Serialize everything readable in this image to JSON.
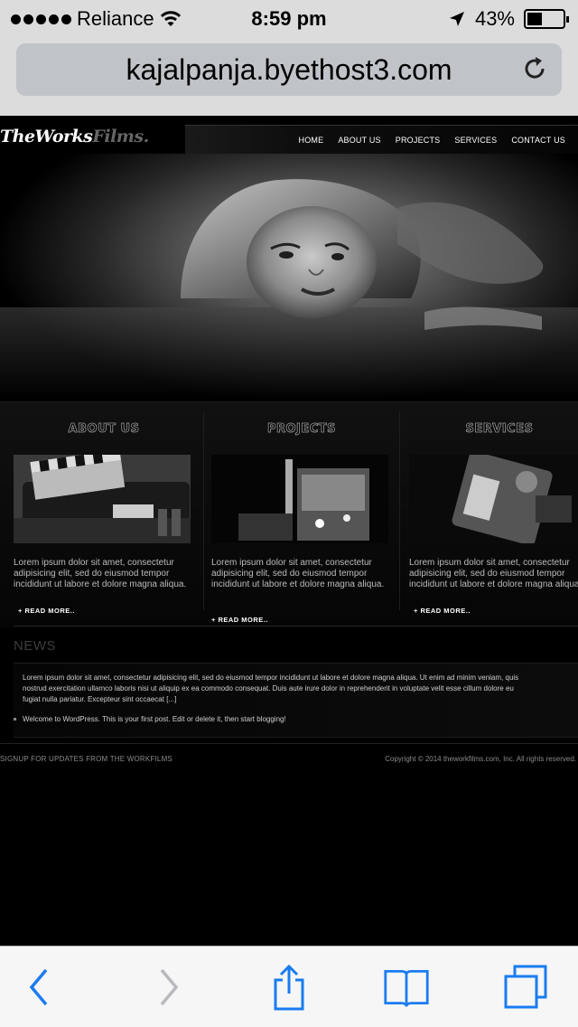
{
  "status_bar": {
    "carrier": "Reliance",
    "time": "8:59 pm",
    "battery": "43%",
    "battery_level": 0.43,
    "icons": [
      "signal-dots-icon",
      "wifi-icon",
      "location-arrow-icon",
      "battery-icon"
    ]
  },
  "url_bar": {
    "url": "kajalpanja.byethost3.com",
    "reload_icon": "reload-icon"
  },
  "site": {
    "logo_main": "TheWorks",
    "logo_suffix": "Films.",
    "nav": [
      "HOME",
      "ABOUT US",
      "PROJECTS",
      "SERVICES",
      "CONTACT US"
    ],
    "columns": [
      {
        "title": "ABOUT US",
        "body": "Lorem ipsum dolor sit amet, consectetur adipisicing elit, sed do eiusmod tempor incididunt ut labore et dolore magna aliqua.",
        "more": "+ READ MORE.."
      },
      {
        "title": "PROJECTS",
        "body": "Lorem ipsum dolor sit amet, consectetur adipisicing elit, sed do eiusmod tempor incididunt ut labore et dolore magna aliqua.",
        "more": "+ READ MORE.."
      },
      {
        "title": "SERVICES",
        "body": "Lorem ipsum dolor sit amet, consectetur adipisicing elit, sed do eiusmod tempor incididunt ut labore et dolore magna aliqua.",
        "more": "+ READ MORE.."
      }
    ],
    "news": {
      "title": "NEWS",
      "excerpt_lines": [
        "Lorem ipsum dolor sit amet, consectetur adipisicing elit, sed do eiusmod tempor incididunt ut labore et dolore magna aliqua. Ut enim ad minim veniam, quis",
        "nostrud exercitation ullamco laboris nisi ut aliquip ex ea commodo consequat. Duis aute irure dolor in reprehenderit in voluptate velit esse cillum dolore eu",
        "fugiat nulla pariatur. Excepteur sint occaecat [...]"
      ],
      "item": "Welcome to WordPress. This is your first post. Edit or delete it, then start blogging!"
    },
    "footer": {
      "signup": "SIGNUP FOR UPDATES FROM THE WORKFILMS",
      "copyright": "Copyright © 2014 theworkfilms.com, Inc. All rights reserved."
    }
  },
  "toolbar": {
    "accent": "#1a7cf0",
    "disabled": "#b9b9bd",
    "buttons": [
      "back-icon",
      "forward-icon",
      "share-icon",
      "bookmarks-icon",
      "tabs-icon"
    ]
  }
}
